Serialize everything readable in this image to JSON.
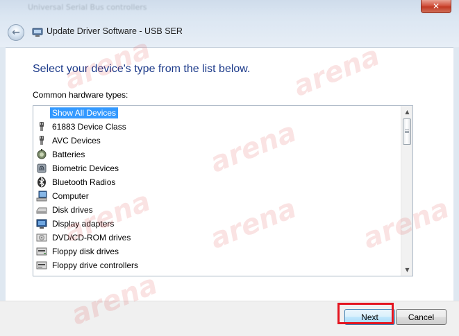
{
  "window": {
    "title": "Update Driver Software - USB SER",
    "close_label": "✕",
    "behind_text": "Universal Serial Bus controllers"
  },
  "content": {
    "heading": "Select your device's type from the list below.",
    "list_label": "Common hardware types:"
  },
  "hardware_types": [
    {
      "label": "Show All Devices",
      "icon": "none",
      "selected": true
    },
    {
      "label": "61883 Device Class",
      "icon": "plug-icon",
      "selected": false
    },
    {
      "label": "AVC Devices",
      "icon": "plug-icon",
      "selected": false
    },
    {
      "label": "Batteries",
      "icon": "battery-icon",
      "selected": false
    },
    {
      "label": "Biometric Devices",
      "icon": "fingerprint-icon",
      "selected": false
    },
    {
      "label": "Bluetooth Radios",
      "icon": "bluetooth-icon",
      "selected": false
    },
    {
      "label": "Computer",
      "icon": "computer-icon",
      "selected": false
    },
    {
      "label": "Disk drives",
      "icon": "disk-drive-icon",
      "selected": false
    },
    {
      "label": "Display adapters",
      "icon": "display-adapter-icon",
      "selected": false
    },
    {
      "label": "DVD/CD-ROM drives",
      "icon": "dvd-drive-icon",
      "selected": false
    },
    {
      "label": "Floppy disk drives",
      "icon": "floppy-drive-icon",
      "selected": false
    },
    {
      "label": "Floppy drive controllers",
      "icon": "floppy-controller-icon",
      "selected": false
    }
  ],
  "footer": {
    "next_label": "Next",
    "cancel_label": "Cancel"
  },
  "watermark": {
    "text": "arena"
  },
  "colors": {
    "heading": "#1c3a8a",
    "selection": "#3399ff",
    "highlight_box": "#e4141f"
  }
}
